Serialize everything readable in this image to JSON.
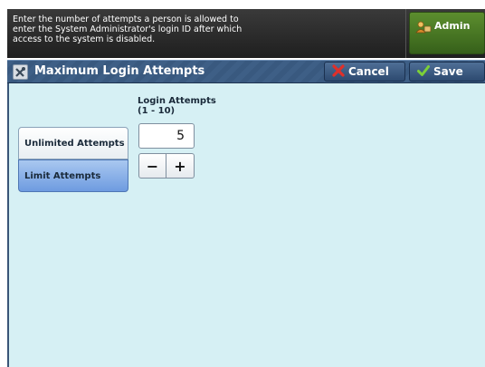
{
  "message": {
    "text": "Enter the number of attempts a person is allowed to\nenter the System Administrator's login ID after which\naccess to the system is disabled."
  },
  "admin_button": {
    "label": "Admin",
    "icon": "admin-user-icon"
  },
  "title_bar": {
    "title": "Maximum Login Attempts",
    "icon": "tools-icon",
    "cancel_label": "Cancel",
    "save_label": "Save"
  },
  "options": {
    "unlimited_label": "Unlimited Attempts",
    "limit_label": "Limit Attempts",
    "selected": "Limit Attempts"
  },
  "login_attempts": {
    "label": "Login Attempts",
    "range": "(1 - 10)",
    "value": "5",
    "minus_label": "−",
    "plus_label": "+"
  },
  "colors": {
    "titlebar": "#3e5f86",
    "content_bg": "#d6f0f4",
    "admin_green": "#4a7a25",
    "selected_option": "#6e9be0"
  }
}
